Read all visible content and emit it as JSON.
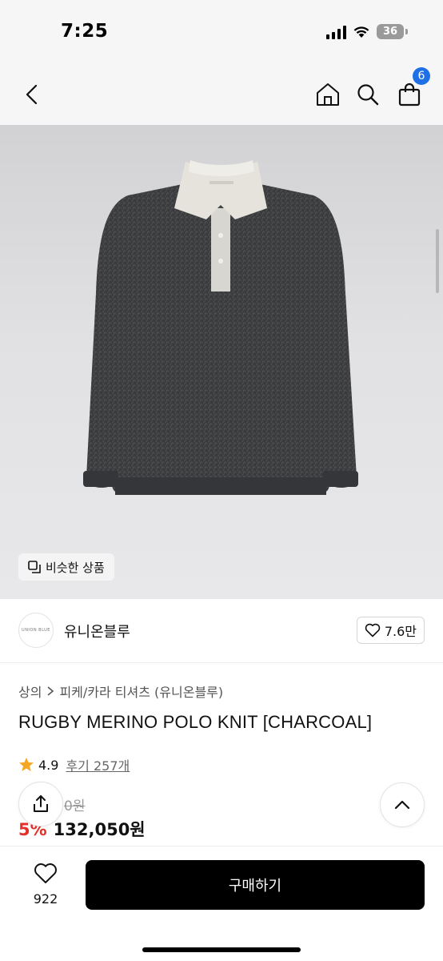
{
  "status_bar": {
    "time": "7:25",
    "battery": "36"
  },
  "nav": {
    "back_icon": "chevron-left-icon",
    "home_icon": "home-icon",
    "search_icon": "search-icon",
    "cart_icon": "shopping-bag-icon",
    "cart_badge": "6",
    "badge_color": "#1f6fe5"
  },
  "hero": {
    "similar_button": "비슷한 상품"
  },
  "brand": {
    "logo_text": "UNION BLUE",
    "name": "유니온블루",
    "likes": "7.6만"
  },
  "product": {
    "breadcrumb": [
      "상의",
      "피케/카라 티셔츠 (유니온블루)"
    ],
    "title": "RUGBY MERINO POLO KNIT [CHARCOAL]",
    "rating": "4.9",
    "reviews": "후기 257개",
    "original_price": "0원",
    "discount": "5%",
    "sale_price": "132,050원",
    "discount_color": "#e3302b",
    "star_color": "#f5a623"
  },
  "bottom_bar": {
    "wish_count": "922",
    "buy_label": "구매하기"
  }
}
